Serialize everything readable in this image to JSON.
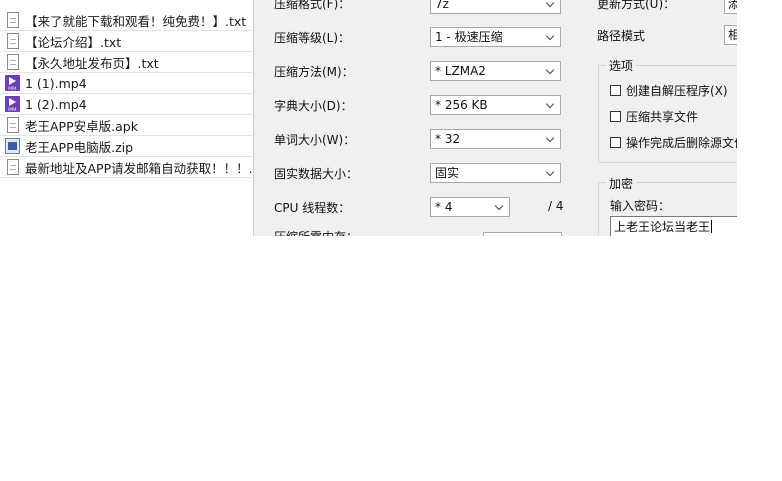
{
  "files": [
    {
      "name": "【来了就能下载和观看！纯免费！】.txt",
      "type": "txt"
    },
    {
      "name": "【论坛介绍】.txt",
      "type": "txt"
    },
    {
      "name": "【永久地址发布页】.txt",
      "type": "txt"
    },
    {
      "name": "1 (1).mp4",
      "type": "mp4"
    },
    {
      "name": "1 (2).mp4",
      "type": "mp4"
    },
    {
      "name": "老王APP安卓版.apk",
      "type": "txt"
    },
    {
      "name": "老王APP电脑版.zip",
      "type": "zip"
    },
    {
      "name": "最新地址及APP请发邮箱自动获取！！！....",
      "type": "txt"
    }
  ],
  "dialog": {
    "format_label": "压缩格式(F)：",
    "format_value": "7z",
    "level_label": "压缩等级(L)：",
    "level_value": "1 - 极速压缩",
    "method_label": "压缩方法(M)：",
    "method_value": "* LZMA2",
    "dict_label": "字典大小(D)：",
    "dict_value": "* 256 KB",
    "word_label": "单词大小(W)：",
    "word_value": "* 32",
    "solid_label": "固实数据大小：",
    "solid_value": "固实",
    "cpu_label": "CPU 线程数：",
    "cpu_value": "* 4",
    "cpu_total": "/ 4",
    "memory_label": "压缩所需内存：",
    "update_label": "更新方式(U)：",
    "update_value": "添",
    "path_label": "路径模式",
    "path_value": "相",
    "options_title": "选项",
    "opt_sfx": "创建自解压程序(X)",
    "opt_shared": "压缩共享文件",
    "opt_delete": "操作完成后删除源文件",
    "encrypt_title": "加密",
    "password_label": "输入密码：",
    "password_value": "上老王论坛当老王"
  }
}
